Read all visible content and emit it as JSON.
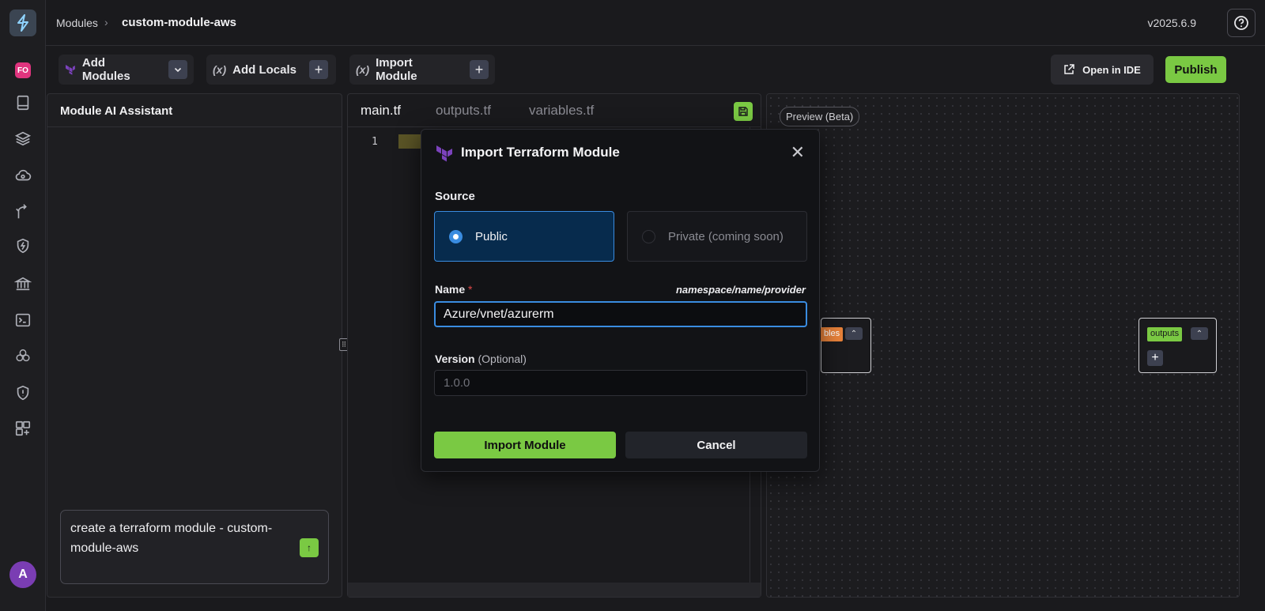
{
  "breadcrumb": {
    "root": "Modules",
    "separator": ">",
    "current": "custom-module-aws"
  },
  "version": "v2025.6.9",
  "org_badge": "FO",
  "user_avatar": "A",
  "toolbar": {
    "add_modules": "Add Modules",
    "add_locals": "Add Locals",
    "add_locals_fx": "(x)",
    "import_module": "Import Module",
    "import_module_fx": "(x)",
    "open_in_ide": "Open in IDE",
    "publish": "Publish"
  },
  "ai_panel": {
    "title": "Module AI Assistant",
    "chat_input": "create a terraform module - custom-module-aws"
  },
  "editor": {
    "tabs": [
      "main.tf",
      "outputs.tf",
      "variables.tf"
    ],
    "active_tab": "main.tf",
    "line_number": "1"
  },
  "preview": {
    "label": "Preview (Beta)",
    "variables_node_tag": "bles",
    "outputs_node_tag": "outputs"
  },
  "modal": {
    "title": "Import Terraform Module",
    "source_label": "Source",
    "source_options": [
      {
        "label": "Public",
        "selected": true
      },
      {
        "label": "Private (coming soon)",
        "selected": false
      }
    ],
    "name_label": "Name",
    "name_required": "*",
    "name_hint": "namespace/name/provider",
    "name_value": "Azure/vnet/azurerm",
    "version_label": "Version",
    "version_optional": "(Optional)",
    "version_placeholder": "1.0.0",
    "import_button": "Import Module",
    "cancel_button": "Cancel"
  },
  "colors": {
    "accent_green": "#7ac943",
    "accent_blue": "#3a8ce0",
    "terraform_purple": "#7b42bc",
    "variables_orange": "#e8823a"
  }
}
